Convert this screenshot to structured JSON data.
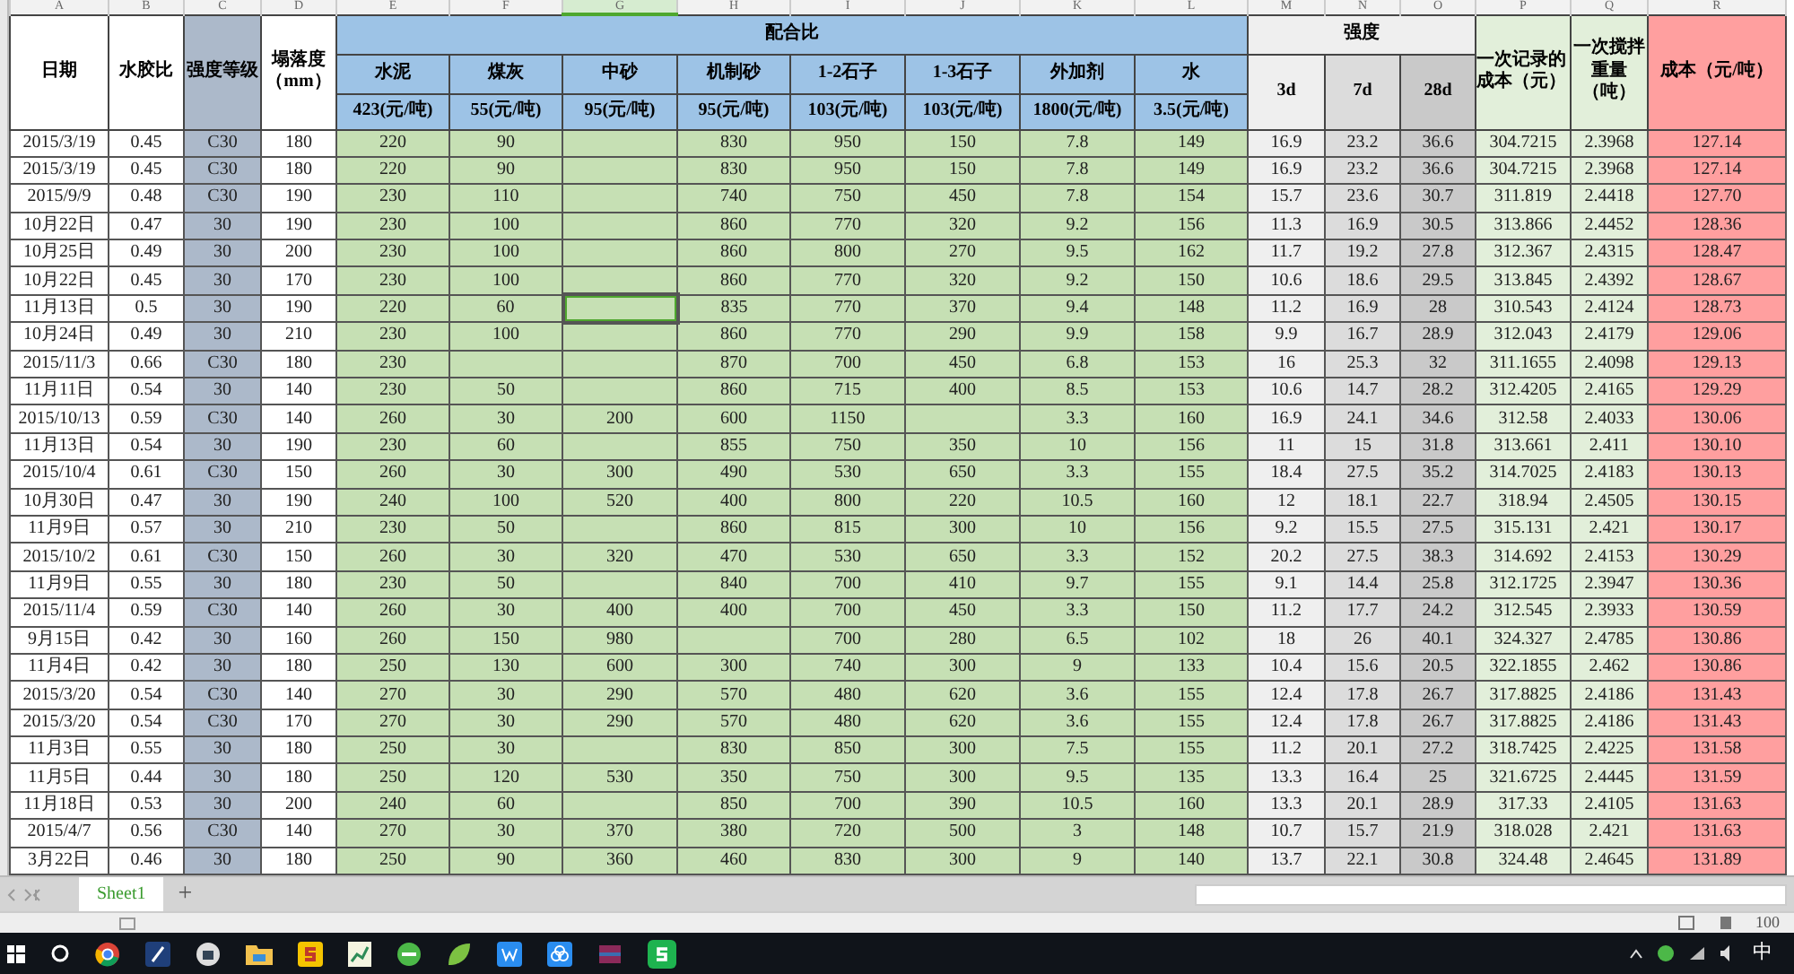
{
  "column_letters": [
    {
      "label": "A",
      "selected": false
    },
    {
      "label": "B",
      "selected": false
    },
    {
      "label": "C",
      "selected": false
    },
    {
      "label": "D",
      "selected": false
    },
    {
      "label": "E",
      "selected": false
    },
    {
      "label": "F",
      "selected": false
    },
    {
      "label": "G",
      "selected": true
    },
    {
      "label": "H",
      "selected": false
    },
    {
      "label": "I",
      "selected": false
    },
    {
      "label": "J",
      "selected": false
    },
    {
      "label": "K",
      "selected": false
    },
    {
      "label": "L",
      "selected": false
    },
    {
      "label": "M",
      "selected": false
    },
    {
      "label": "N",
      "selected": false
    },
    {
      "label": "O",
      "selected": false
    },
    {
      "label": "P",
      "selected": false
    },
    {
      "label": "Q",
      "selected": false
    },
    {
      "label": "R",
      "selected": false
    }
  ],
  "header": {
    "date": "日期",
    "wc_ratio": "水胶比",
    "grade": "强度等级",
    "slump": "塌落度（mm）",
    "mix_group": "配合比",
    "materials": [
      {
        "name": "水泥",
        "price": "423(元/吨)"
      },
      {
        "name": "煤灰",
        "price": "55(元/吨)"
      },
      {
        "name": "中砂",
        "price": "95(元/吨)"
      },
      {
        "name": "机制砂",
        "price": "95(元/吨)"
      },
      {
        "name": "1-2石子",
        "price": "103(元/吨)"
      },
      {
        "name": "1-3石子",
        "price": "103(元/吨)"
      },
      {
        "name": "外加剂",
        "price": "1800(元/吨)"
      },
      {
        "name": "水",
        "price": "3.5(元/吨)"
      }
    ],
    "strength_group": "强度",
    "strength_ages": [
      "3d",
      "7d",
      "28d"
    ],
    "cost_record": "一次记录的成本（元）",
    "batch_weight": "一次搅拌重量（吨）",
    "cost_per_ton": "成本（元/吨）"
  },
  "rows": [
    {
      "selected": false,
      "cells": [
        "2015/3/19",
        "0.45",
        "C30",
        "180",
        "220",
        "90",
        null,
        "830",
        "950",
        "150",
        "7.8",
        "149",
        "16.9",
        "23.2",
        "36.6",
        "304.7215",
        "2.3968",
        "127.14"
      ]
    },
    {
      "selected": false,
      "cells": [
        "2015/3/19",
        "0.45",
        "C30",
        "180",
        "220",
        "90",
        null,
        "830",
        "950",
        "150",
        "7.8",
        "149",
        "16.9",
        "23.2",
        "36.6",
        "304.7215",
        "2.3968",
        "127.14"
      ]
    },
    {
      "selected": false,
      "cells": [
        "2015/9/9",
        "0.48",
        "C30",
        "190",
        "230",
        "110",
        null,
        "740",
        "750",
        "450",
        "7.8",
        "154",
        "15.7",
        "23.6",
        "30.7",
        "311.819",
        "2.4418",
        "127.70"
      ]
    },
    {
      "selected": false,
      "cells": [
        "10月22日",
        "0.47",
        "30",
        "190",
        "230",
        "100",
        null,
        "860",
        "770",
        "320",
        "9.2",
        "156",
        "11.3",
        "16.9",
        "30.5",
        "313.866",
        "2.4452",
        "128.36"
      ]
    },
    {
      "selected": false,
      "cells": [
        "10月25日",
        "0.49",
        "30",
        "200",
        "230",
        "100",
        null,
        "860",
        "800",
        "270",
        "9.5",
        "162",
        "11.7",
        "19.2",
        "27.8",
        "312.367",
        "2.4315",
        "128.47"
      ]
    },
    {
      "selected": false,
      "cells": [
        "10月22日",
        "0.45",
        "30",
        "170",
        "230",
        "100",
        null,
        "860",
        "770",
        "320",
        "9.2",
        "150",
        "10.6",
        "18.6",
        "29.5",
        "313.845",
        "2.4392",
        "128.67"
      ]
    },
    {
      "selected": true,
      "cells": [
        "11月13日",
        "0.5",
        "30",
        "190",
        "220",
        "60",
        null,
        "835",
        "770",
        "370",
        "9.4",
        "148",
        "11.2",
        "16.9",
        "28",
        "310.543",
        "2.4124",
        "128.73"
      ]
    },
    {
      "selected": false,
      "cells": [
        "10月24日",
        "0.49",
        "30",
        "210",
        "230",
        "100",
        null,
        "860",
        "770",
        "290",
        "9.9",
        "158",
        "9.9",
        "16.7",
        "28.9",
        "312.043",
        "2.4179",
        "129.06"
      ]
    },
    {
      "selected": false,
      "cells": [
        "2015/11/3",
        "0.66",
        "C30",
        "180",
        "230",
        null,
        null,
        "870",
        "700",
        "450",
        "6.8",
        "153",
        "16",
        "25.3",
        "32",
        "311.1655",
        "2.4098",
        "129.13"
      ]
    },
    {
      "selected": false,
      "cells": [
        "11月11日",
        "0.54",
        "30",
        "140",
        "230",
        "50",
        null,
        "860",
        "715",
        "400",
        "8.5",
        "153",
        "10.6",
        "14.7",
        "28.2",
        "312.4205",
        "2.4165",
        "129.29"
      ]
    },
    {
      "selected": false,
      "cells": [
        "2015/10/13",
        "0.59",
        "C30",
        "140",
        "260",
        "30",
        "200",
        "600",
        "1150",
        null,
        "3.3",
        "160",
        "16.9",
        "24.1",
        "34.6",
        "312.58",
        "2.4033",
        "130.06"
      ]
    },
    {
      "selected": false,
      "cells": [
        "11月13日",
        "0.54",
        "30",
        "190",
        "230",
        "60",
        null,
        "855",
        "750",
        "350",
        "10",
        "156",
        "11",
        "15",
        "31.8",
        "313.661",
        "2.411",
        "130.10"
      ]
    },
    {
      "selected": false,
      "cells": [
        "2015/10/4",
        "0.61",
        "C30",
        "150",
        "260",
        "30",
        "300",
        "490",
        "530",
        "650",
        "3.3",
        "155",
        "18.4",
        "27.5",
        "35.2",
        "314.7025",
        "2.4183",
        "130.13"
      ]
    },
    {
      "selected": false,
      "cells": [
        "10月30日",
        "0.47",
        "30",
        "190",
        "240",
        "100",
        "520",
        "400",
        "800",
        "220",
        "10.5",
        "160",
        "12",
        "18.1",
        "22.7",
        "318.94",
        "2.4505",
        "130.15"
      ]
    },
    {
      "selected": false,
      "cells": [
        "11月9日",
        "0.57",
        "30",
        "210",
        "230",
        "50",
        null,
        "860",
        "815",
        "300",
        "10",
        "156",
        "9.2",
        "15.5",
        "27.5",
        "315.131",
        "2.421",
        "130.17"
      ]
    },
    {
      "selected": false,
      "cells": [
        "2015/10/2",
        "0.61",
        "C30",
        "150",
        "260",
        "30",
        "320",
        "470",
        "530",
        "650",
        "3.3",
        "152",
        "20.2",
        "27.5",
        "38.3",
        "314.692",
        "2.4153",
        "130.29"
      ]
    },
    {
      "selected": false,
      "cells": [
        "11月9日",
        "0.55",
        "30",
        "180",
        "230",
        "50",
        null,
        "840",
        "700",
        "410",
        "9.7",
        "155",
        "9.1",
        "14.4",
        "25.8",
        "312.1725",
        "2.3947",
        "130.36"
      ]
    },
    {
      "selected": false,
      "cells": [
        "2015/11/4",
        "0.59",
        "C30",
        "140",
        "260",
        "30",
        "400",
        "400",
        "700",
        "450",
        "3.3",
        "150",
        "11.2",
        "17.7",
        "24.2",
        "312.545",
        "2.3933",
        "130.59"
      ]
    },
    {
      "selected": false,
      "cells": [
        "9月15日",
        "0.42",
        "30",
        "160",
        "260",
        "150",
        "980",
        null,
        "700",
        "280",
        "6.5",
        "102",
        "18",
        "26",
        "40.1",
        "324.327",
        "2.4785",
        "130.86"
      ]
    },
    {
      "selected": false,
      "cells": [
        "11月4日",
        "0.42",
        "30",
        "180",
        "250",
        "130",
        "600",
        "300",
        "740",
        "300",
        "9",
        "133",
        "10.4",
        "15.6",
        "20.5",
        "322.1855",
        "2.462",
        "130.86"
      ]
    },
    {
      "selected": false,
      "cells": [
        "2015/3/20",
        "0.54",
        "C30",
        "140",
        "270",
        "30",
        "290",
        "570",
        "480",
        "620",
        "3.6",
        "155",
        "12.4",
        "17.8",
        "26.7",
        "317.8825",
        "2.4186",
        "131.43"
      ]
    },
    {
      "selected": false,
      "cells": [
        "2015/3/20",
        "0.54",
        "C30",
        "170",
        "270",
        "30",
        "290",
        "570",
        "480",
        "620",
        "3.6",
        "155",
        "12.4",
        "17.8",
        "26.7",
        "317.8825",
        "2.4186",
        "131.43"
      ]
    },
    {
      "selected": false,
      "cells": [
        "11月3日",
        "0.55",
        "30",
        "180",
        "250",
        "30",
        null,
        "830",
        "850",
        "300",
        "7.5",
        "155",
        "11.2",
        "20.1",
        "27.2",
        "318.7425",
        "2.4225",
        "131.58"
      ]
    },
    {
      "selected": false,
      "cells": [
        "11月5日",
        "0.44",
        "30",
        "180",
        "250",
        "120",
        "530",
        "350",
        "750",
        "300",
        "9.5",
        "135",
        "13.3",
        "16.4",
        "25",
        "321.6725",
        "2.4445",
        "131.59"
      ]
    },
    {
      "selected": false,
      "cells": [
        "11月18日",
        "0.53",
        "30",
        "200",
        "240",
        "60",
        null,
        "850",
        "700",
        "390",
        "10.5",
        "160",
        "13.3",
        "20.1",
        "28.9",
        "317.33",
        "2.4105",
        "131.63"
      ]
    },
    {
      "selected": false,
      "cells": [
        "2015/4/7",
        "0.56",
        "C30",
        "140",
        "270",
        "30",
        "370",
        "380",
        "720",
        "500",
        "3",
        "148",
        "10.7",
        "15.7",
        "21.9",
        "318.028",
        "2.421",
        "131.63"
      ]
    },
    {
      "selected": false,
      "cells": [
        "3月22日",
        "0.46",
        "30",
        "180",
        "250",
        "90",
        "360",
        "460",
        "830",
        "300",
        "9",
        "140",
        "13.7",
        "22.1",
        "30.8",
        "324.48",
        "2.4645",
        "131.89"
      ]
    }
  ],
  "sheet_tabs": [
    {
      "label": "Sheet1",
      "selected": true
    }
  ],
  "add_sheet": "+",
  "zoom": "100",
  "tray": {
    "input_method": "中"
  }
}
